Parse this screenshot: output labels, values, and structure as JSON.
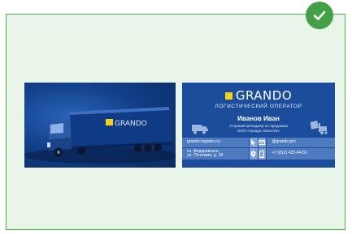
{
  "back_card": {
    "logo": "GRANDO",
    "tagline": "ЛОГИСТИЧЕСКИЙ ОПЕРАТОР",
    "name": "Иванов Иван",
    "role_line1": "Старший менеджер по продажам",
    "role_line2": "ООО «Грандо Логистик»",
    "website": "grando-logistics.ru",
    "email": "@grando.pro",
    "address_line1": "сп. Федоровское,",
    "address_line2": "ул. Почтовая, д. 18",
    "phone": "+7 (812) 423-64-50"
  },
  "front_card": {
    "trailer_logo": "GRANDO"
  },
  "icons": [
    "check-icon",
    "truck-icon",
    "forklift-icon",
    "cursor-icon",
    "mail-icon",
    "location-icon",
    "phone-icon"
  ],
  "colors": {
    "badge": "#43a047",
    "frame_border": "#4caf50",
    "frame_bg": "#eaf5e9",
    "card_blue": "#1b4d9c",
    "logo_yellow": "#f3d21c"
  }
}
